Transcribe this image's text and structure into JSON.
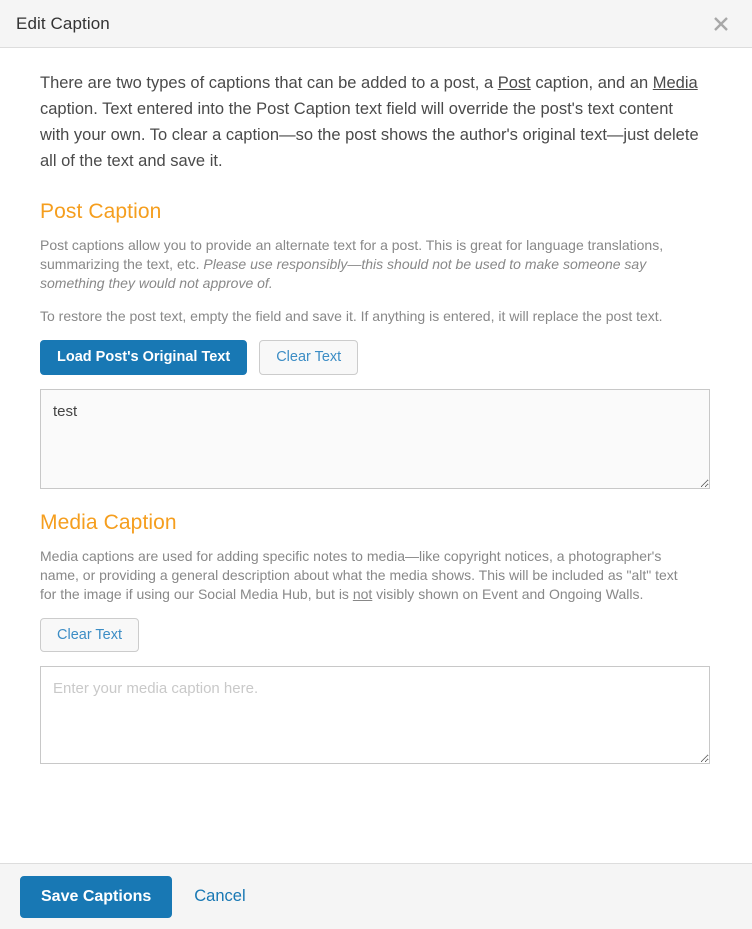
{
  "header": {
    "title": "Edit Caption",
    "close_icon": "close-icon"
  },
  "intro": {
    "part1": "There are two types of captions that can be added to a post, a ",
    "link_post": "Post",
    "part2": " caption, and an ",
    "link_media": "Media",
    "part3": " caption. Text entered into the Post Caption text field will override the post's text content with your own. To clear a caption—so the post shows the author's original text—just delete all of the text and save it."
  },
  "post_caption": {
    "heading": "Post Caption",
    "desc_plain": "Post captions allow you to provide an alternate text for a post. This is great for language translations, summarizing the text, etc. ",
    "desc_italic": "Please use responsibly—this should not be used to make someone say something they would not approve of.",
    "restore_note": "To restore the post text, empty the field and save it. If anything is entered, it will replace the post text.",
    "load_button": "Load Post's Original Text",
    "clear_button": "Clear Text",
    "textarea_value": "test",
    "textarea_placeholder": ""
  },
  "media_caption": {
    "heading": "Media Caption",
    "desc_part1": "Media captions are used for adding specific notes to media—like copyright notices, a photographer's name, or providing a general description about what the media shows. This will be included as \"alt\" text for the image if using our Social Media Hub, but is ",
    "desc_underline": "not",
    "desc_part2": " visibly shown on Event and Ongoing Walls.",
    "clear_button": "Clear Text",
    "textarea_value": "",
    "textarea_placeholder": "Enter your media caption here."
  },
  "footer": {
    "save_button": "Save Captions",
    "cancel_link": "Cancel"
  },
  "colors": {
    "accent_blue": "#1878b4",
    "heading_orange": "#f59e1e",
    "link_blue": "#3c8dc5",
    "header_bg": "#f5f5f5",
    "border": "#dddddd"
  }
}
